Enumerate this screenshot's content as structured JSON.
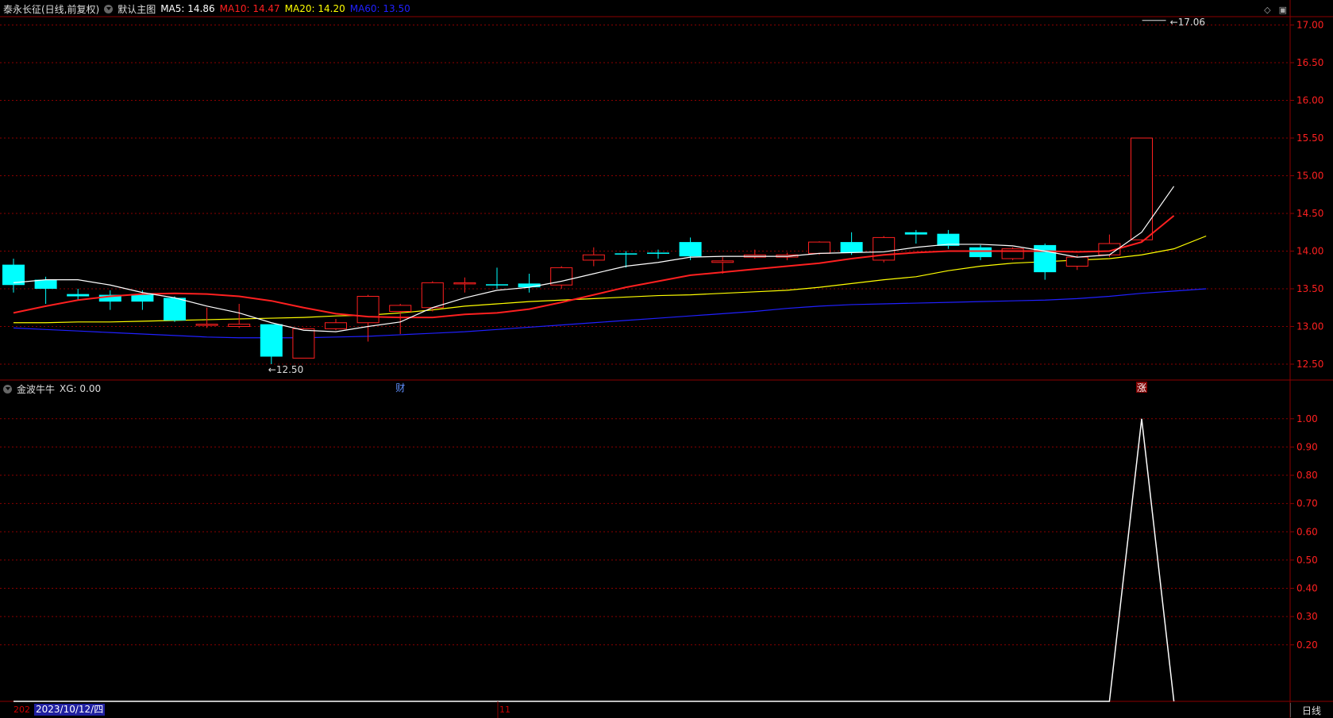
{
  "header": {
    "title": "泰永长征(日线,前复权)",
    "template_label": "默认主图",
    "ma": [
      {
        "label": "MA5: 14.86",
        "color": "#ffffff"
      },
      {
        "label": "MA10: 14.47",
        "color": "#ff2020"
      },
      {
        "label": "MA20: 14.20",
        "color": "#ffff00"
      },
      {
        "label": "MA60: 13.50",
        "color": "#2020ff"
      }
    ]
  },
  "indicator_header": {
    "name": "金波牛牛",
    "value_label": "XG: 0.00"
  },
  "window_icons": [
    "diamond-icon",
    "restore-icon"
  ],
  "footer": {
    "year_fragment": "202",
    "cursor_date": "2023/10/12/四",
    "month_marker": "11",
    "period_tab": "日线"
  },
  "colors": {
    "up": "#ff2020",
    "down": "#00ffff",
    "grid": "#8b0000",
    "axis_text": "#ff2020",
    "ma5": "#ffffff",
    "ma10": "#ff2020",
    "ma20": "#ffff00",
    "ma60": "#2020ff"
  },
  "chart_data": [
    {
      "type": "candlestick",
      "title": "泰永长征(日线,前复权)",
      "ylim": [
        12.3,
        17.1
      ],
      "yticks": [
        12.5,
        13.0,
        13.5,
        14.0,
        14.5,
        15.0,
        15.5,
        16.0,
        16.5,
        17.0
      ],
      "high_marker": {
        "value": 17.06,
        "label": "17.06",
        "index": 36
      },
      "low_marker": {
        "value": 12.5,
        "label": "12.50",
        "index": 8
      },
      "event_markers": [
        {
          "index": 12,
          "label": "财"
        },
        {
          "index": 35,
          "label": "涨"
        }
      ],
      "candles": [
        {
          "o": 13.82,
          "h": 13.9,
          "c": 13.55,
          "l": 13.45
        },
        {
          "o": 13.62,
          "h": 13.66,
          "c": 13.5,
          "l": 13.3
        },
        {
          "o": 13.43,
          "h": 13.5,
          "c": 13.4,
          "l": 13.35
        },
        {
          "o": 13.42,
          "h": 13.48,
          "c": 13.33,
          "l": 13.22
        },
        {
          "o": 13.43,
          "h": 13.48,
          "c": 13.33,
          "l": 13.22
        },
        {
          "o": 13.38,
          "h": 13.4,
          "c": 13.08,
          "l": 13.06
        },
        {
          "o": 13.02,
          "h": 13.25,
          "c": 13.03,
          "l": 12.98
        },
        {
          "o": 13.0,
          "h": 13.3,
          "c": 13.03,
          "l": 12.98
        },
        {
          "o": 13.03,
          "h": 13.03,
          "c": 12.6,
          "l": 12.5
        },
        {
          "o": 12.58,
          "h": 12.98,
          "c": 12.97,
          "l": 12.58
        },
        {
          "o": 12.97,
          "h": 13.1,
          "c": 13.05,
          "l": 12.95
        },
        {
          "o": 13.05,
          "h": 13.42,
          "c": 13.4,
          "l": 12.8
        },
        {
          "o": 13.2,
          "h": 13.3,
          "c": 13.28,
          "l": 12.9
        },
        {
          "o": 13.25,
          "h": 13.6,
          "c": 13.58,
          "l": 13.2
        },
        {
          "o": 13.57,
          "h": 13.65,
          "c": 13.58,
          "l": 13.45
        },
        {
          "o": 13.56,
          "h": 13.78,
          "c": 13.55,
          "l": 13.5
        },
        {
          "o": 13.57,
          "h": 13.7,
          "c": 13.52,
          "l": 13.45
        },
        {
          "o": 13.55,
          "h": 13.8,
          "c": 13.78,
          "l": 13.5
        },
        {
          "o": 13.88,
          "h": 14.05,
          "c": 13.95,
          "l": 13.8
        },
        {
          "o": 13.97,
          "h": 14.0,
          "c": 13.96,
          "l": 13.78
        },
        {
          "o": 13.98,
          "h": 14.02,
          "c": 13.97,
          "l": 13.9
        },
        {
          "o": 14.12,
          "h": 14.18,
          "c": 13.93,
          "l": 13.88
        },
        {
          "o": 13.85,
          "h": 13.92,
          "c": 13.87,
          "l": 13.7
        },
        {
          "o": 13.92,
          "h": 14.02,
          "c": 13.95,
          "l": 13.9
        },
        {
          "o": 13.92,
          "h": 13.98,
          "c": 13.95,
          "l": 13.88
        },
        {
          "o": 13.97,
          "h": 14.13,
          "c": 14.12,
          "l": 13.95
        },
        {
          "o": 14.12,
          "h": 14.25,
          "c": 13.98,
          "l": 13.95
        },
        {
          "o": 13.88,
          "h": 14.2,
          "c": 14.18,
          "l": 13.85
        },
        {
          "o": 14.25,
          "h": 14.28,
          "c": 14.22,
          "l": 14.1
        },
        {
          "o": 14.23,
          "h": 14.28,
          "c": 14.07,
          "l": 14.03
        },
        {
          "o": 14.05,
          "h": 14.08,
          "c": 13.92,
          "l": 13.88
        },
        {
          "o": 13.9,
          "h": 14.05,
          "c": 14.03,
          "l": 13.88
        },
        {
          "o": 14.08,
          "h": 14.1,
          "c": 13.72,
          "l": 13.62
        },
        {
          "o": 13.8,
          "h": 13.95,
          "c": 13.92,
          "l": 13.75
        },
        {
          "o": 13.95,
          "h": 14.22,
          "c": 14.1,
          "l": 13.92
        },
        {
          "o": 14.15,
          "h": 15.5,
          "c": 15.5,
          "l": 14.12
        }
      ],
      "ma5": [
        13.58,
        13.62,
        13.62,
        13.55,
        13.45,
        13.38,
        13.27,
        13.18,
        13.05,
        12.95,
        12.93,
        13.0,
        13.06,
        13.25,
        13.38,
        13.48,
        13.52,
        13.6,
        13.7,
        13.8,
        13.85,
        13.92,
        13.93,
        13.93,
        13.93,
        13.97,
        13.98,
        13.99,
        14.05,
        14.09,
        14.09,
        14.07,
        14.0,
        13.92,
        13.95,
        14.25,
        14.86
      ],
      "ma10": [
        13.18,
        13.27,
        13.35,
        13.4,
        13.43,
        13.44,
        13.43,
        13.4,
        13.34,
        13.25,
        13.17,
        13.13,
        13.12,
        13.12,
        13.16,
        13.18,
        13.23,
        13.32,
        13.42,
        13.52,
        13.6,
        13.68,
        13.72,
        13.76,
        13.8,
        13.84,
        13.9,
        13.95,
        13.98,
        14.0,
        14.0,
        14.0,
        14.0,
        13.99,
        14.0,
        14.12,
        14.47
      ],
      "ma20": [
        13.05,
        13.05,
        13.06,
        13.06,
        13.07,
        13.08,
        13.09,
        13.1,
        13.11,
        13.12,
        13.14,
        13.15,
        13.18,
        13.22,
        13.27,
        13.3,
        13.33,
        13.35,
        13.37,
        13.39,
        13.41,
        13.42,
        13.44,
        13.46,
        13.48,
        13.52,
        13.57,
        13.62,
        13.66,
        13.74,
        13.8,
        13.84,
        13.86,
        13.88,
        13.9,
        13.95,
        14.03,
        14.2
      ],
      "ma60": [
        12.98,
        12.96,
        12.94,
        12.92,
        12.9,
        12.88,
        12.86,
        12.85,
        12.85,
        12.85,
        12.86,
        12.87,
        12.89,
        12.91,
        12.93,
        12.96,
        12.99,
        13.02,
        13.05,
        13.08,
        13.11,
        13.14,
        13.17,
        13.2,
        13.24,
        13.27,
        13.29,
        13.3,
        13.31,
        13.32,
        13.33,
        13.34,
        13.35,
        13.37,
        13.4,
        13.44,
        13.47,
        13.5
      ]
    },
    {
      "type": "line",
      "title": "金波牛牛",
      "ylim": [
        0,
        1.05
      ],
      "yticks": [
        0.2,
        0.3,
        0.4,
        0.5,
        0.6,
        0.7,
        0.8,
        0.9,
        1.0
      ],
      "series": [
        {
          "name": "XG",
          "color": "#ffffff",
          "values": [
            0,
            0,
            0,
            0,
            0,
            0,
            0,
            0,
            0,
            0,
            0,
            0,
            0,
            0,
            0,
            0,
            0,
            0,
            0,
            0,
            0,
            0,
            0,
            0,
            0,
            0,
            0,
            0,
            0,
            0,
            0,
            0,
            0,
            0,
            0,
            1,
            0
          ]
        }
      ]
    }
  ]
}
